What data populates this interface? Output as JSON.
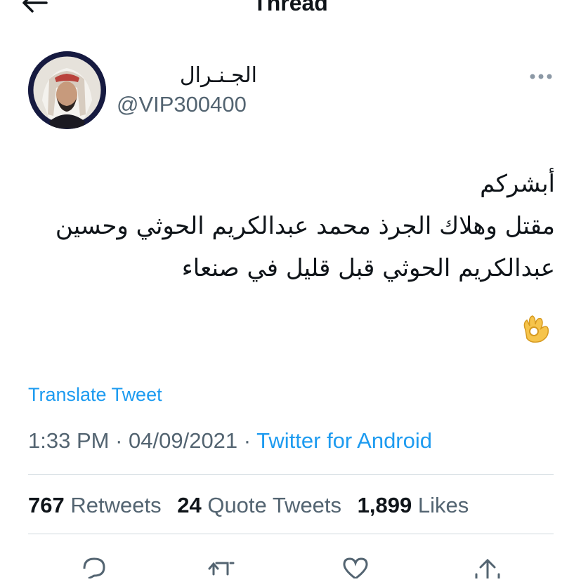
{
  "header": {
    "title": "Thread",
    "back_icon": "arrow-left-icon"
  },
  "tweet": {
    "author": {
      "name": "الجـنـرال",
      "handle": "@VIP300400"
    },
    "more_icon": "ellipsis-icon",
    "text_lines": [
      "أبشركم",
      "مقتل وهلاك الجرذ محمد عبدالكريم الحوثي وحسين",
      "عبدالكريم الحوثي قبل قليل في صنعاء"
    ],
    "emoji": "👌",
    "translate_label": "Translate Tweet",
    "time": "1:33 PM",
    "separator": " · ",
    "date": "04/09/2021",
    "source": "Twitter for Android",
    "stats": {
      "retweets_count": "767",
      "retweets_label": "Retweets",
      "quotes_count": "24",
      "quotes_label": "Quote Tweets",
      "likes_count": "1,899",
      "likes_label": "Likes"
    },
    "actions": [
      "reply-icon",
      "retweet-icon",
      "like-icon",
      "share-icon"
    ]
  },
  "colors": {
    "text": "#0f1419",
    "secondary": "#536471",
    "link": "#1d9bf0",
    "divider": "#cfd9de"
  }
}
